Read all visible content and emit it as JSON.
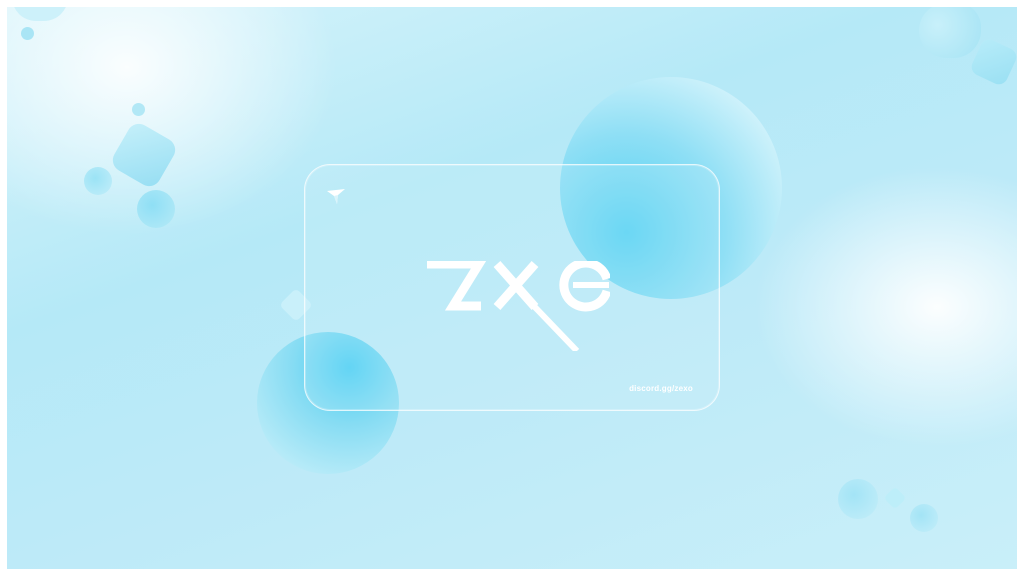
{
  "brand": {
    "wordmark": "ZXO",
    "logo_icon": "triangle-mark-icon"
  },
  "card": {
    "link_text": "discord.gg/zexo"
  },
  "colors": {
    "background_light": "#d8f4fb",
    "accent_cyan": "#4fd0f2",
    "text": "#ffffff"
  }
}
